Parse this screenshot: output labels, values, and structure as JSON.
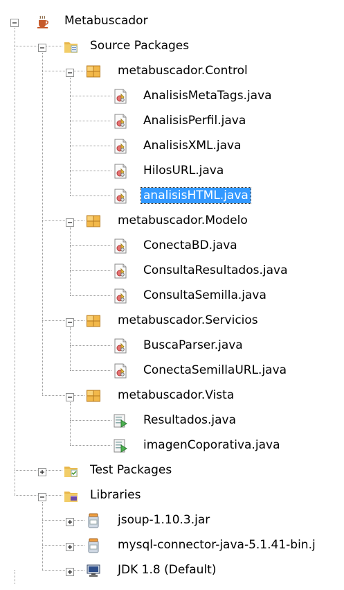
{
  "project": {
    "label": "Metabuscador",
    "icon": "java-project-icon"
  },
  "tree": [
    {
      "level": 1,
      "label": "Metabuscador",
      "icon": "java-project",
      "toggle": "minus"
    },
    {
      "level": 2,
      "label": "Source Packages",
      "icon": "source-folder",
      "toggle": "minus"
    },
    {
      "level": 3,
      "label": "metabuscador.Control",
      "icon": "package",
      "toggle": "minus"
    },
    {
      "level": 4,
      "label": "AnalisisMetaTags.java",
      "icon": "java-class"
    },
    {
      "level": 4,
      "label": "AnalisisPerfil.java",
      "icon": "java-class"
    },
    {
      "level": 4,
      "label": "AnalisisXML.java",
      "icon": "java-class"
    },
    {
      "level": 4,
      "label": "HilosURL.java",
      "icon": "java-class"
    },
    {
      "level": 4,
      "label": "analisisHTML.java",
      "icon": "java-class",
      "selected": true
    },
    {
      "level": 3,
      "label": "metabuscador.Modelo",
      "icon": "package",
      "toggle": "minus"
    },
    {
      "level": 4,
      "label": "ConectaBD.java",
      "icon": "java-class"
    },
    {
      "level": 4,
      "label": "ConsultaResultados.java",
      "icon": "java-class"
    },
    {
      "level": 4,
      "label": "ConsultaSemilla.java",
      "icon": "java-class"
    },
    {
      "level": 3,
      "label": "metabuscador.Servicios",
      "icon": "package",
      "toggle": "minus"
    },
    {
      "level": 4,
      "label": "BuscaParser.java",
      "icon": "java-class"
    },
    {
      "level": 4,
      "label": "ConectaSemillaURL.java",
      "icon": "java-class"
    },
    {
      "level": 3,
      "label": "metabuscador.Vista",
      "icon": "package",
      "toggle": "minus"
    },
    {
      "level": 4,
      "label": "Resultados.java",
      "icon": "java-form"
    },
    {
      "level": 4,
      "label": "imagenCoporativa.java",
      "icon": "java-form"
    },
    {
      "level": 2,
      "label": "Test Packages",
      "icon": "test-folder",
      "toggle": "plus"
    },
    {
      "level": 2,
      "label": "Libraries",
      "icon": "library-folder",
      "toggle": "minus"
    },
    {
      "level": 3,
      "label": "jsoup-1.10.3.jar",
      "icon": "jar",
      "toggle": "plus"
    },
    {
      "level": 3,
      "label": "mysql-connector-java-5.1.41-bin.j",
      "icon": "jar",
      "toggle": "plus"
    },
    {
      "level": 3,
      "label": "JDK 1.8 (Default)",
      "icon": "jdk",
      "toggle": "plus"
    }
  ],
  "colors": {
    "selection": "#3399ff",
    "package": "#e8a33a",
    "folder": "#d9a441"
  }
}
